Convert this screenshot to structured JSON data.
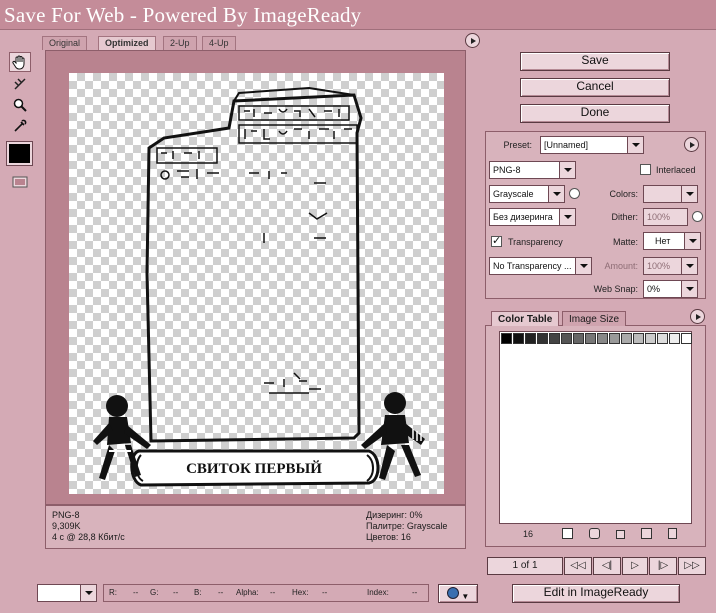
{
  "window": {
    "title": "Save For Web - Powered By ImageReady"
  },
  "tabs": [
    {
      "label": "Original"
    },
    {
      "label": "Optimized"
    },
    {
      "label": "2-Up"
    },
    {
      "label": "4-Up"
    }
  ],
  "image": {
    "banner_text": "СВИТОК ПЕРВЫЙ"
  },
  "info_left": {
    "format": "PNG-8",
    "size": "9,309K",
    "time": "4 с @ 28,8 Кбит/с"
  },
  "info_right": {
    "dither": "Дизеринг: 0%",
    "palette": "Палитре: Grayscale",
    "colors": "Цветов: 16"
  },
  "buttons": {
    "save": "Save",
    "cancel": "Cancel",
    "done": "Done",
    "edit_imageready": "Edit in ImageReady"
  },
  "settings": {
    "preset_label": "Preset:",
    "preset_value": "[Unnamed]",
    "format": "PNG-8",
    "interlaced_label": "Interlaced",
    "reduction": "Grayscale",
    "colors_label": "Colors:",
    "dither_algorithm": "Без дизеринга",
    "dither_label": "Dither:",
    "dither_value": "100%",
    "transparency_label": "Transparency",
    "matte_label": "Matte:",
    "matte_value": "Нет",
    "transparency_dither": "No Transparency ...",
    "amount_label": "Amount:",
    "amount_value": "100%",
    "websnap_label": "Web Snap:",
    "websnap_value": "0%"
  },
  "color_table": {
    "tabs": [
      {
        "label": "Color Table"
      },
      {
        "label": "Image Size"
      }
    ],
    "count": "16",
    "swatches": [
      "#000000",
      "#111111",
      "#222222",
      "#333333",
      "#444444",
      "#555555",
      "#666666",
      "#777777",
      "#888888",
      "#999999",
      "#aaaaaa",
      "#bbbbbb",
      "#cccccc",
      "#dddddd",
      "#eeeeee",
      "#ffffff"
    ]
  },
  "navigation": {
    "page": "1 of 1"
  },
  "status": {
    "r": "R:",
    "r_val": "--",
    "g": "G:",
    "g_val": "--",
    "b": "B:",
    "b_val": "--",
    "alpha": "Alpha:",
    "alpha_val": "--",
    "hex": "Hex:",
    "hex_val": "--",
    "index": "Index:",
    "index_val": "--"
  },
  "colors": {
    "title_bg": "#c48c99",
    "window_bg": "#d4aab5",
    "frame": "#b9838f"
  }
}
